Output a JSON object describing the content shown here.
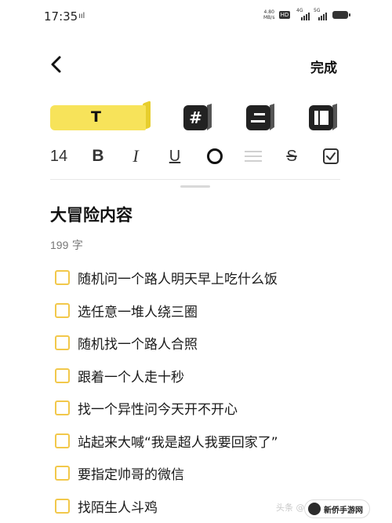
{
  "status_bar": {
    "time": "17:35",
    "left_icon": "ııl",
    "net_speed_value": "4.80",
    "net_speed_unit": "MB/s",
    "hd_label": "HD",
    "sig1_label": "4G",
    "sig2_label": "5G"
  },
  "nav": {
    "back_icon": "chevron-left-icon",
    "done_label": "完成"
  },
  "toolbar": {
    "text_style_glyph": "T",
    "text_style_active_color": "#f7e35a",
    "font_size": "14",
    "bold": "B",
    "italic": "I",
    "underline": "U",
    "strike": "S"
  },
  "note": {
    "title": "大冒险内容",
    "word_count_num": "199",
    "word_count_unit": "字",
    "items": [
      {
        "text": "随机问一个路人明天早上吃什么饭",
        "checked": false
      },
      {
        "text": "选任意一堆人绕三圈",
        "checked": false
      },
      {
        "text": "随机找一个路人合照",
        "checked": false
      },
      {
        "text": "跟着一个人走十秒",
        "checked": false
      },
      {
        "text": "找一个异性问今天开不开心",
        "checked": false
      },
      {
        "text": "站起来大喊“我是超人我要回家了”",
        "checked": false
      },
      {
        "text": "要指定帅哥的微信",
        "checked": false
      },
      {
        "text": "找陌生人斗鸡",
        "checked": false
      }
    ]
  },
  "watermark": {
    "ghost_text": "头条 @",
    "badge_text": "新侨手游网"
  },
  "colors": {
    "accent_yellow": "#f7e35a",
    "checkbox_border": "#f2c84b"
  }
}
